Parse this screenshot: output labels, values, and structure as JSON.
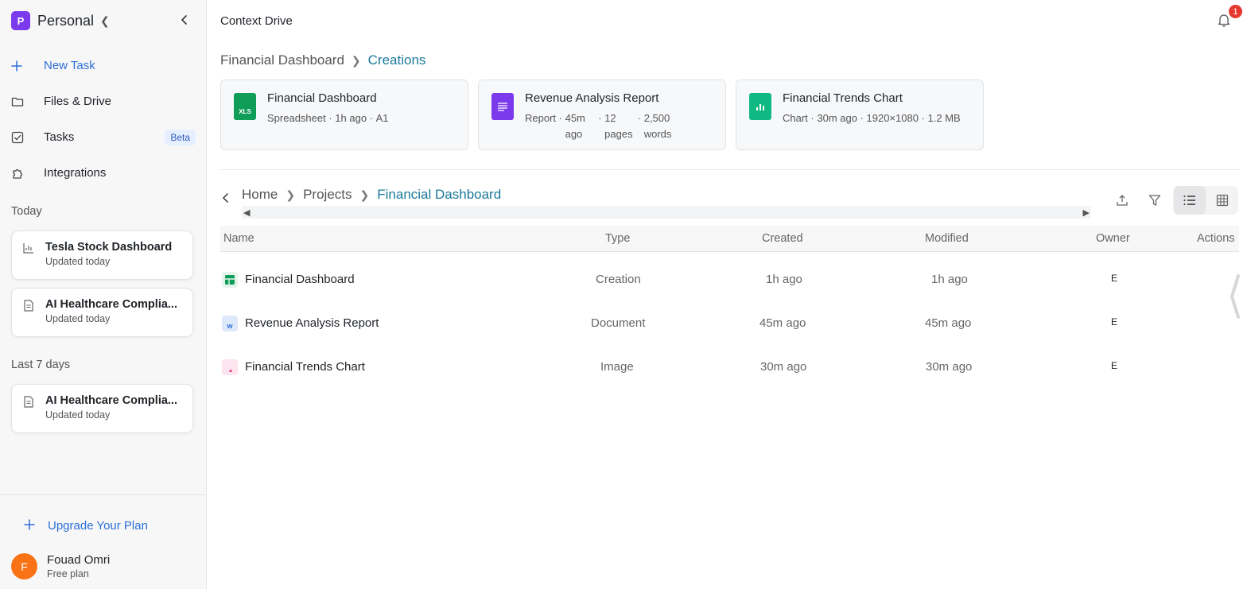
{
  "sidebar": {
    "workspace": {
      "initial": "P",
      "name": "Personal"
    },
    "nav": [
      {
        "label": "New Task",
        "icon": "plus-icon"
      },
      {
        "label": "Files & Drive",
        "icon": "folder-icon"
      },
      {
        "label": "Tasks",
        "icon": "checkbox-icon",
        "badge": "Beta"
      },
      {
        "label": "Integrations",
        "icon": "puzzle-icon"
      }
    ],
    "sections": [
      {
        "title": "Today"
      },
      {
        "title": "Last 7 days"
      }
    ],
    "history": [
      {
        "title": "Tesla Stock Dashboard",
        "sub": "Updated today",
        "icon": "chart-icon"
      },
      {
        "title": "AI Healthcare Complia...",
        "sub": "Updated today",
        "icon": "document-icon"
      },
      {
        "title": "AI Healthcare Complia...",
        "sub": "Updated today",
        "icon": "document-icon"
      }
    ],
    "upgrade": "Upgrade Your Plan",
    "user": {
      "initial": "F",
      "name": "Fouad Omri",
      "plan": "Free plan"
    }
  },
  "header": {
    "title": "Context Drive",
    "notifications": "1"
  },
  "creations_breadcrumb": [
    "Financial Dashboard",
    "Creations"
  ],
  "cards": [
    {
      "title": "Financial Dashboard",
      "meta": [
        "Spreadsheet",
        "1h ago",
        "A1"
      ],
      "icon_label": "XLS",
      "color": "#0f9d58"
    },
    {
      "title": "Revenue Analysis Report",
      "meta": [
        "Report",
        "45m ago",
        "12 pages",
        "2,500 words"
      ],
      "icon_label": "",
      "color": "#7c3aed"
    },
    {
      "title": "Financial Trends Chart",
      "meta": [
        "Chart",
        "30m ago",
        "1920×1080",
        "1.2 MB"
      ],
      "icon_label": "",
      "color": "#10b981"
    }
  ],
  "path_breadcrumb": [
    "Home",
    "Projects",
    "Financial Dashboard"
  ],
  "table": {
    "columns": [
      "Name",
      "Type",
      "Created",
      "Modified",
      "Owner",
      "Actions"
    ],
    "rows": [
      {
        "name": "Financial Dashboard",
        "type": "Creation",
        "created": "1h ago",
        "modified": "1h ago",
        "owner": "E",
        "icon": "sheet-icon"
      },
      {
        "name": "Revenue Analysis Report",
        "type": "Document",
        "created": "45m ago",
        "modified": "45m ago",
        "owner": "E",
        "icon": "word-icon"
      },
      {
        "name": "Financial Trends Chart",
        "type": "Image",
        "created": "30m ago",
        "modified": "30m ago",
        "owner": "E",
        "icon": "image-icon"
      }
    ]
  },
  "colors": {
    "accent": "#2c6fd6",
    "breadcrumb_current": "#1a7a9a",
    "workspace": "#7c3aed",
    "user_avatar": "#f97316",
    "badge": "#e5392f"
  }
}
